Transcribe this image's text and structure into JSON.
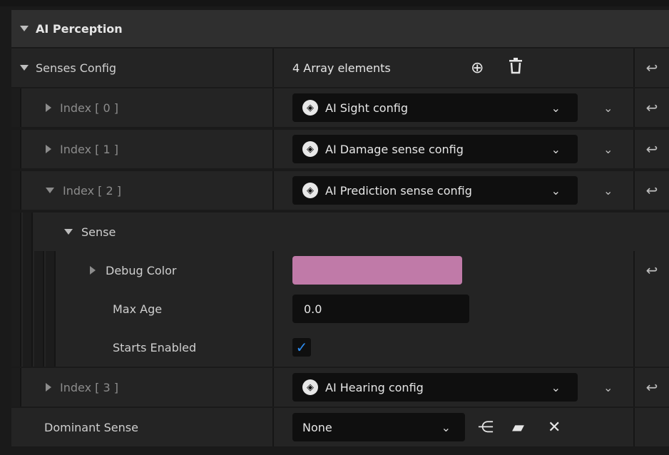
{
  "header": {
    "title": "AI Perception"
  },
  "senses_config": {
    "label": "Senses Config",
    "array_summary": "4 Array elements",
    "add_icon": "plus-circle-icon",
    "delete_icon": "trash-icon"
  },
  "indices": [
    {
      "label": "Index [ 0 ]",
      "value": "AI Sight config"
    },
    {
      "label": "Index [ 1 ]",
      "value": "AI Damage sense config"
    },
    {
      "label": "Index [ 2 ]",
      "value": "AI Prediction sense config"
    },
    {
      "label": "Index [ 3 ]",
      "value": "AI Hearing config"
    }
  ],
  "sense": {
    "label": "Sense",
    "debug_color_label": "Debug Color",
    "debug_color": "#c07aa8",
    "max_age_label": "Max Age",
    "max_age_value": "0.0",
    "starts_enabled_label": "Starts Enabled",
    "starts_enabled": true
  },
  "dominant_sense": {
    "label": "Dominant Sense",
    "value": "None"
  },
  "colors": {
    "accent_check": "#2d8cf0",
    "row_bg": "#242424",
    "header_bg": "#2f2f2f"
  }
}
